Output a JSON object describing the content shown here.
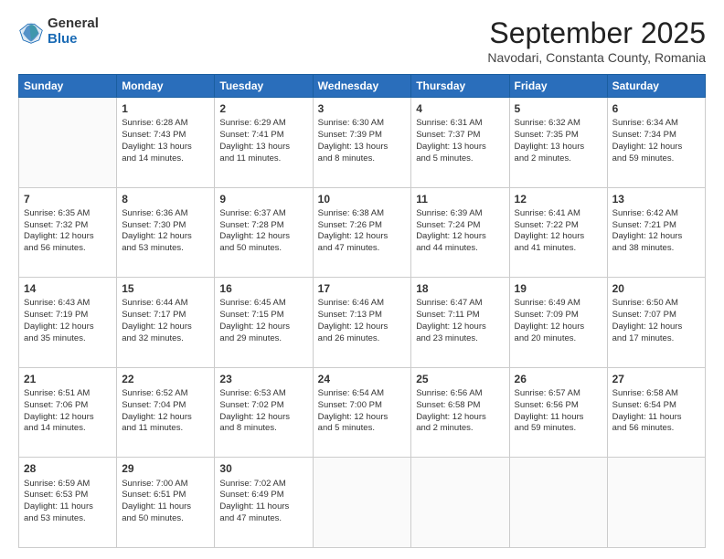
{
  "logo": {
    "general": "General",
    "blue": "Blue"
  },
  "title": {
    "month": "September 2025",
    "location": "Navodari, Constanta County, Romania"
  },
  "days": [
    "Sunday",
    "Monday",
    "Tuesday",
    "Wednesday",
    "Thursday",
    "Friday",
    "Saturday"
  ],
  "weeks": [
    [
      {
        "num": "",
        "info": ""
      },
      {
        "num": "1",
        "info": "Sunrise: 6:28 AM\nSunset: 7:43 PM\nDaylight: 13 hours\nand 14 minutes."
      },
      {
        "num": "2",
        "info": "Sunrise: 6:29 AM\nSunset: 7:41 PM\nDaylight: 13 hours\nand 11 minutes."
      },
      {
        "num": "3",
        "info": "Sunrise: 6:30 AM\nSunset: 7:39 PM\nDaylight: 13 hours\nand 8 minutes."
      },
      {
        "num": "4",
        "info": "Sunrise: 6:31 AM\nSunset: 7:37 PM\nDaylight: 13 hours\nand 5 minutes."
      },
      {
        "num": "5",
        "info": "Sunrise: 6:32 AM\nSunset: 7:35 PM\nDaylight: 13 hours\nand 2 minutes."
      },
      {
        "num": "6",
        "info": "Sunrise: 6:34 AM\nSunset: 7:34 PM\nDaylight: 12 hours\nand 59 minutes."
      }
    ],
    [
      {
        "num": "7",
        "info": "Sunrise: 6:35 AM\nSunset: 7:32 PM\nDaylight: 12 hours\nand 56 minutes."
      },
      {
        "num": "8",
        "info": "Sunrise: 6:36 AM\nSunset: 7:30 PM\nDaylight: 12 hours\nand 53 minutes."
      },
      {
        "num": "9",
        "info": "Sunrise: 6:37 AM\nSunset: 7:28 PM\nDaylight: 12 hours\nand 50 minutes."
      },
      {
        "num": "10",
        "info": "Sunrise: 6:38 AM\nSunset: 7:26 PM\nDaylight: 12 hours\nand 47 minutes."
      },
      {
        "num": "11",
        "info": "Sunrise: 6:39 AM\nSunset: 7:24 PM\nDaylight: 12 hours\nand 44 minutes."
      },
      {
        "num": "12",
        "info": "Sunrise: 6:41 AM\nSunset: 7:22 PM\nDaylight: 12 hours\nand 41 minutes."
      },
      {
        "num": "13",
        "info": "Sunrise: 6:42 AM\nSunset: 7:21 PM\nDaylight: 12 hours\nand 38 minutes."
      }
    ],
    [
      {
        "num": "14",
        "info": "Sunrise: 6:43 AM\nSunset: 7:19 PM\nDaylight: 12 hours\nand 35 minutes."
      },
      {
        "num": "15",
        "info": "Sunrise: 6:44 AM\nSunset: 7:17 PM\nDaylight: 12 hours\nand 32 minutes."
      },
      {
        "num": "16",
        "info": "Sunrise: 6:45 AM\nSunset: 7:15 PM\nDaylight: 12 hours\nand 29 minutes."
      },
      {
        "num": "17",
        "info": "Sunrise: 6:46 AM\nSunset: 7:13 PM\nDaylight: 12 hours\nand 26 minutes."
      },
      {
        "num": "18",
        "info": "Sunrise: 6:47 AM\nSunset: 7:11 PM\nDaylight: 12 hours\nand 23 minutes."
      },
      {
        "num": "19",
        "info": "Sunrise: 6:49 AM\nSunset: 7:09 PM\nDaylight: 12 hours\nand 20 minutes."
      },
      {
        "num": "20",
        "info": "Sunrise: 6:50 AM\nSunset: 7:07 PM\nDaylight: 12 hours\nand 17 minutes."
      }
    ],
    [
      {
        "num": "21",
        "info": "Sunrise: 6:51 AM\nSunset: 7:06 PM\nDaylight: 12 hours\nand 14 minutes."
      },
      {
        "num": "22",
        "info": "Sunrise: 6:52 AM\nSunset: 7:04 PM\nDaylight: 12 hours\nand 11 minutes."
      },
      {
        "num": "23",
        "info": "Sunrise: 6:53 AM\nSunset: 7:02 PM\nDaylight: 12 hours\nand 8 minutes."
      },
      {
        "num": "24",
        "info": "Sunrise: 6:54 AM\nSunset: 7:00 PM\nDaylight: 12 hours\nand 5 minutes."
      },
      {
        "num": "25",
        "info": "Sunrise: 6:56 AM\nSunset: 6:58 PM\nDaylight: 12 hours\nand 2 minutes."
      },
      {
        "num": "26",
        "info": "Sunrise: 6:57 AM\nSunset: 6:56 PM\nDaylight: 11 hours\nand 59 minutes."
      },
      {
        "num": "27",
        "info": "Sunrise: 6:58 AM\nSunset: 6:54 PM\nDaylight: 11 hours\nand 56 minutes."
      }
    ],
    [
      {
        "num": "28",
        "info": "Sunrise: 6:59 AM\nSunset: 6:53 PM\nDaylight: 11 hours\nand 53 minutes."
      },
      {
        "num": "29",
        "info": "Sunrise: 7:00 AM\nSunset: 6:51 PM\nDaylight: 11 hours\nand 50 minutes."
      },
      {
        "num": "30",
        "info": "Sunrise: 7:02 AM\nSunset: 6:49 PM\nDaylight: 11 hours\nand 47 minutes."
      },
      {
        "num": "",
        "info": ""
      },
      {
        "num": "",
        "info": ""
      },
      {
        "num": "",
        "info": ""
      },
      {
        "num": "",
        "info": ""
      }
    ]
  ]
}
